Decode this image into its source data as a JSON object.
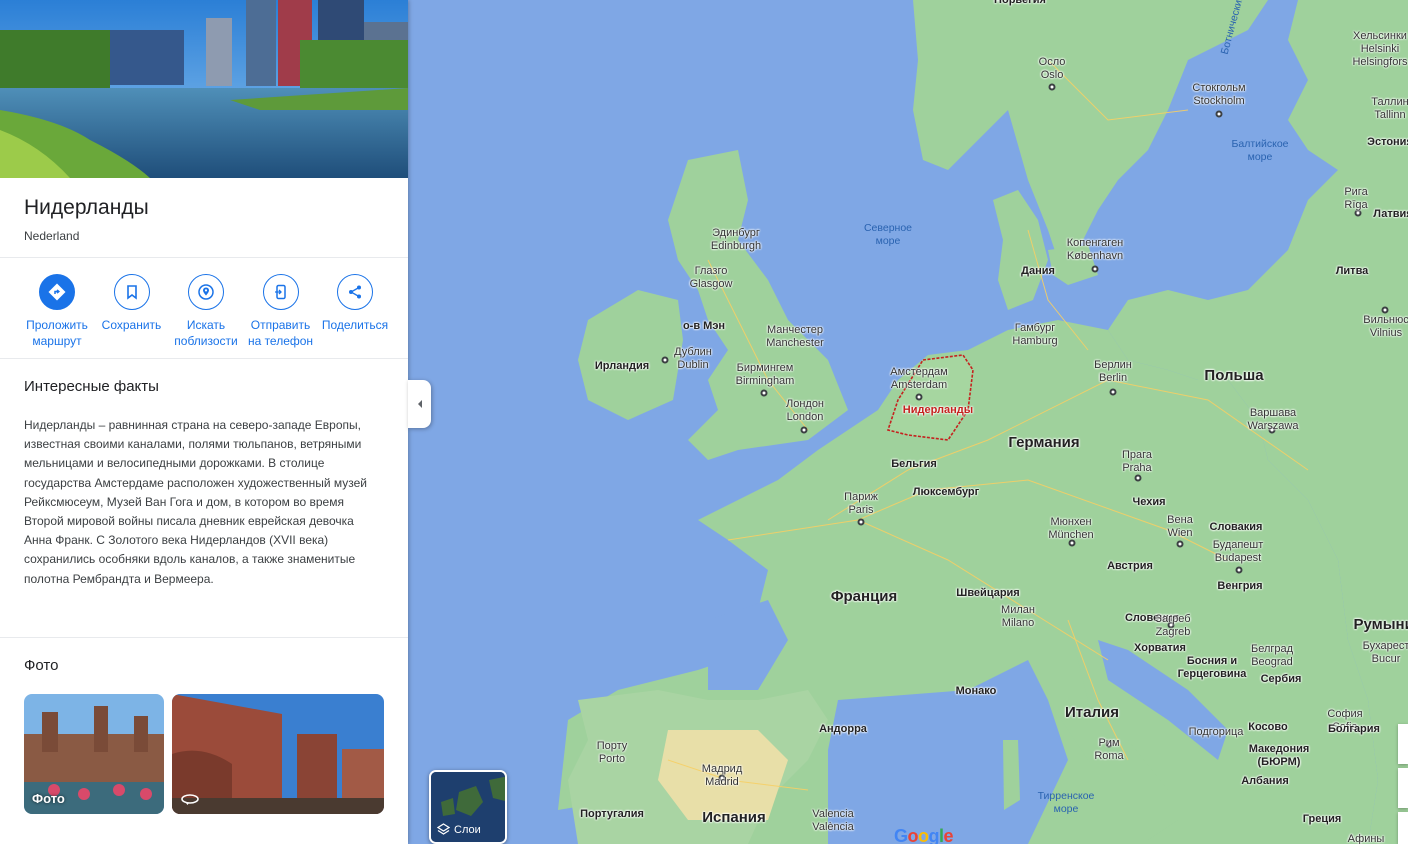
{
  "place": {
    "title": "Нидерланды",
    "subtitle": "Nederland"
  },
  "actions": [
    {
      "label": "Проложить\nмаршрут",
      "icon": "directions-icon"
    },
    {
      "label": "Сохранить",
      "icon": "bookmark-icon"
    },
    {
      "label": "Искать\nпоблизости",
      "icon": "nearby-icon"
    },
    {
      "label": "Отправить\nна телефон",
      "icon": "send-to-phone-icon"
    },
    {
      "label": "Поделиться",
      "icon": "share-icon"
    }
  ],
  "facts": {
    "title": "Интересные факты",
    "text": "Нидерланды – равнинная страна на северо-западе Европы, известная своими каналами, полями тюльпанов, ветряными мельницами и велосипедными дорожками. В столице государства Амстердаме расположен художественный музей Рейксмюсеум, Музей Ван Гога и дом, в котором во время Второй мировой войны писала дневник еврейская девочка Анна Франк. С Золотого века Нидерландов (XVII века) сохранились особняки вдоль каналов, а также знаменитые полотна Рембрандта и Вермеера."
  },
  "photos": {
    "title": "Фото",
    "items": [
      {
        "label": "Фото",
        "icon": "photo-icon"
      },
      {
        "label": "",
        "icon": "360-view-icon"
      }
    ]
  },
  "map": {
    "layers_label": "Слои",
    "logo": "Google",
    "highlight_color": "#c5221f",
    "water_color": "#7fa7e5",
    "land_color": "#9fd19c",
    "labels": [
      {
        "text": "Норвегия",
        "kind": "countrysm"
      },
      {
        "text": "Осло\nOslo",
        "kind": "city"
      },
      {
        "text": "Стокгольм\nStockholm",
        "kind": "city"
      },
      {
        "text": "Хельсинки\nHelsinki\nHelsingfors",
        "kind": "city"
      },
      {
        "text": "Таллин\nTallinn",
        "kind": "city"
      },
      {
        "text": "Эстония",
        "kind": "countrysm"
      },
      {
        "text": "Балтийское\nморе",
        "kind": "sea"
      },
      {
        "text": "Северное\nморе",
        "kind": "sea"
      },
      {
        "text": "Ботнический",
        "kind": "sea"
      },
      {
        "text": "Рига\nRīga",
        "kind": "city"
      },
      {
        "text": "Латвия",
        "kind": "countrysm"
      },
      {
        "text": "Литва",
        "kind": "countrysm"
      },
      {
        "text": "Вильнюс\nVilnius",
        "kind": "city"
      },
      {
        "text": "Эдинбург\nEdinburgh",
        "kind": "city"
      },
      {
        "text": "Глазго\nGlasgow",
        "kind": "city"
      },
      {
        "text": "о-в Мэн",
        "kind": "countrysm"
      },
      {
        "text": "Дублин\nDublin",
        "kind": "city"
      },
      {
        "text": "Ирландия",
        "kind": "countrysm"
      },
      {
        "text": "Манчестер\nManchester",
        "kind": "city"
      },
      {
        "text": "Бирмингем\nBirmingham",
        "kind": "city"
      },
      {
        "text": "Лондон\nLondon",
        "kind": "city"
      },
      {
        "text": "Копенгаген\nKøbenhavn",
        "kind": "city"
      },
      {
        "text": "Дания",
        "kind": "countrysm"
      },
      {
        "text": "Гамбург\nHamburg",
        "kind": "city"
      },
      {
        "text": "Берлин\nBerlin",
        "kind": "city"
      },
      {
        "text": "Польша",
        "kind": "country"
      },
      {
        "text": "Варшава\nWarszawa",
        "kind": "city"
      },
      {
        "text": "Амстердам\nAmsterdam",
        "kind": "city"
      },
      {
        "text": "Нидерланды",
        "kind": "highlight"
      },
      {
        "text": "Германия",
        "kind": "country"
      },
      {
        "text": "Бельгия",
        "kind": "countrysm"
      },
      {
        "text": "Прага\nPraha",
        "kind": "city"
      },
      {
        "text": "Чехия",
        "kind": "countrysm"
      },
      {
        "text": "Париж\nParis",
        "kind": "city"
      },
      {
        "text": "Люксембург",
        "kind": "countrysm"
      },
      {
        "text": "Мюнхен\nMünchen",
        "kind": "city"
      },
      {
        "text": "Вена\nWien",
        "kind": "city"
      },
      {
        "text": "Словакия",
        "kind": "countrysm"
      },
      {
        "text": "Будапешт\nBudapest",
        "kind": "city"
      },
      {
        "text": "Австрия",
        "kind": "countrysm"
      },
      {
        "text": "Франция",
        "kind": "country"
      },
      {
        "text": "Швейцария",
        "kind": "countrysm"
      },
      {
        "text": "Венгрия",
        "kind": "countrysm"
      },
      {
        "text": "Милан\nMilano",
        "kind": "city"
      },
      {
        "text": "Словения",
        "kind": "countrysm"
      },
      {
        "text": "Загреб\nZagreb",
        "kind": "city"
      },
      {
        "text": "Хорватия",
        "kind": "countrysm"
      },
      {
        "text": "Румыния",
        "kind": "country"
      },
      {
        "text": "Белград\nBeograd",
        "kind": "city"
      },
      {
        "text": "Бухарест\nBucur",
        "kind": "city"
      },
      {
        "text": "Босния и\nГерцеговина",
        "kind": "countrysm"
      },
      {
        "text": "Сербия",
        "kind": "countrysm"
      },
      {
        "text": "Монако",
        "kind": "countrysm"
      },
      {
        "text": "Италия",
        "kind": "country"
      },
      {
        "text": "Андорра",
        "kind": "countrysm"
      },
      {
        "text": "Порту\nPorto",
        "kind": "city"
      },
      {
        "text": "Мадрид\nMadrid",
        "kind": "city"
      },
      {
        "text": "Рим\nRoma",
        "kind": "city"
      },
      {
        "text": "Подгорица",
        "kind": "city"
      },
      {
        "text": "Косово",
        "kind": "countrysm"
      },
      {
        "text": "София\nSofia",
        "kind": "city"
      },
      {
        "text": "Болгария",
        "kind": "countrysm"
      },
      {
        "text": "Македония\n(БЮРМ)",
        "kind": "countrysm"
      },
      {
        "text": "Албания",
        "kind": "countrysm"
      },
      {
        "text": "Тирренское\nморе",
        "kind": "sea"
      },
      {
        "text": "Португалия",
        "kind": "countrysm"
      },
      {
        "text": "Испания",
        "kind": "country"
      },
      {
        "text": "Valencia\nValència",
        "kind": "city"
      },
      {
        "text": "Греция",
        "kind": "countrysm"
      },
      {
        "text": "Афины",
        "kind": "city"
      }
    ]
  }
}
